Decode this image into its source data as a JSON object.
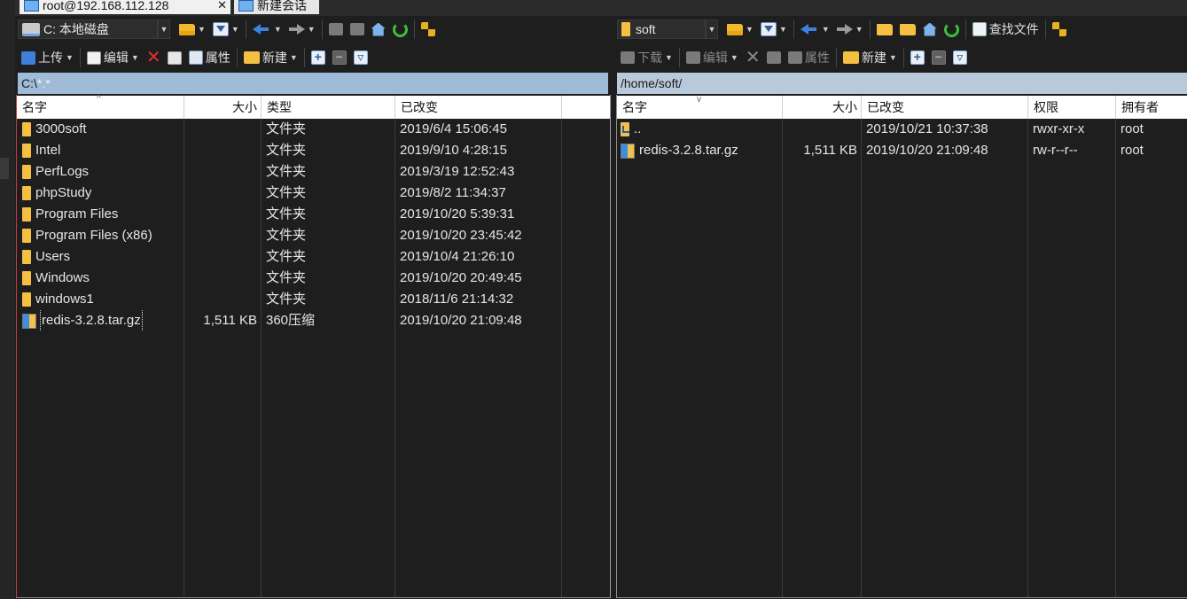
{
  "tabs": [
    {
      "label": "root@192.168.112.128",
      "close": "✕",
      "active": true
    },
    {
      "label": "新建会话",
      "active": false
    }
  ],
  "left": {
    "drive": "C: 本地磁盘",
    "toolbar2": {
      "upload": "上传",
      "edit": "编辑",
      "properties": "属性",
      "new": "新建"
    },
    "path_prefix": "C:\\",
    "path_filter": "*.*",
    "columns": {
      "name": "名字",
      "size": "大小",
      "type": "类型",
      "modified": "已改变"
    },
    "files": [
      {
        "name": "3000soft",
        "size": "",
        "type": "文件夹",
        "modified": "2019/6/4  15:06:45",
        "icon": "folder"
      },
      {
        "name": "Intel",
        "size": "",
        "type": "文件夹",
        "modified": "2019/9/10  4:28:15",
        "icon": "folder"
      },
      {
        "name": "PerfLogs",
        "size": "",
        "type": "文件夹",
        "modified": "2019/3/19  12:52:43",
        "icon": "folder"
      },
      {
        "name": "phpStudy",
        "size": "",
        "type": "文件夹",
        "modified": "2019/8/2  11:34:37",
        "icon": "folder"
      },
      {
        "name": "Program Files",
        "size": "",
        "type": "文件夹",
        "modified": "2019/10/20  5:39:31",
        "icon": "folder"
      },
      {
        "name": "Program Files (x86)",
        "size": "",
        "type": "文件夹",
        "modified": "2019/10/20  23:45:42",
        "icon": "folder"
      },
      {
        "name": "Users",
        "size": "",
        "type": "文件夹",
        "modified": "2019/10/4  21:26:10",
        "icon": "folder"
      },
      {
        "name": "Windows",
        "size": "",
        "type": "文件夹",
        "modified": "2019/10/20  20:49:45",
        "icon": "folder"
      },
      {
        "name": "windows1",
        "size": "",
        "type": "文件夹",
        "modified": "2018/11/6  21:14:32",
        "icon": "folder"
      },
      {
        "name": "redis-3.2.8.tar.gz",
        "size": "1,511 KB",
        "type": "360压缩",
        "modified": "2019/10/20  21:09:48",
        "icon": "archive",
        "focused": true
      }
    ]
  },
  "right": {
    "folder": "soft",
    "find_files": "查找文件",
    "toolbar2": {
      "download": "下载",
      "edit": "编辑",
      "properties": "属性",
      "new": "新建"
    },
    "path": "/home/soft/",
    "columns": {
      "name": "名字",
      "size": "大小",
      "modified": "已改变",
      "permissions": "权限",
      "owner": "拥有者"
    },
    "files": [
      {
        "name": "..",
        "size": "",
        "modified": "2019/10/21 10:37:38",
        "permissions": "rwxr-xr-x",
        "owner": "root",
        "icon": "parent"
      },
      {
        "name": "redis-3.2.8.tar.gz",
        "size": "1,511 KB",
        "modified": "2019/10/20 21:09:48",
        "permissions": "rw-r--r--",
        "owner": "root",
        "icon": "archive"
      }
    ]
  }
}
